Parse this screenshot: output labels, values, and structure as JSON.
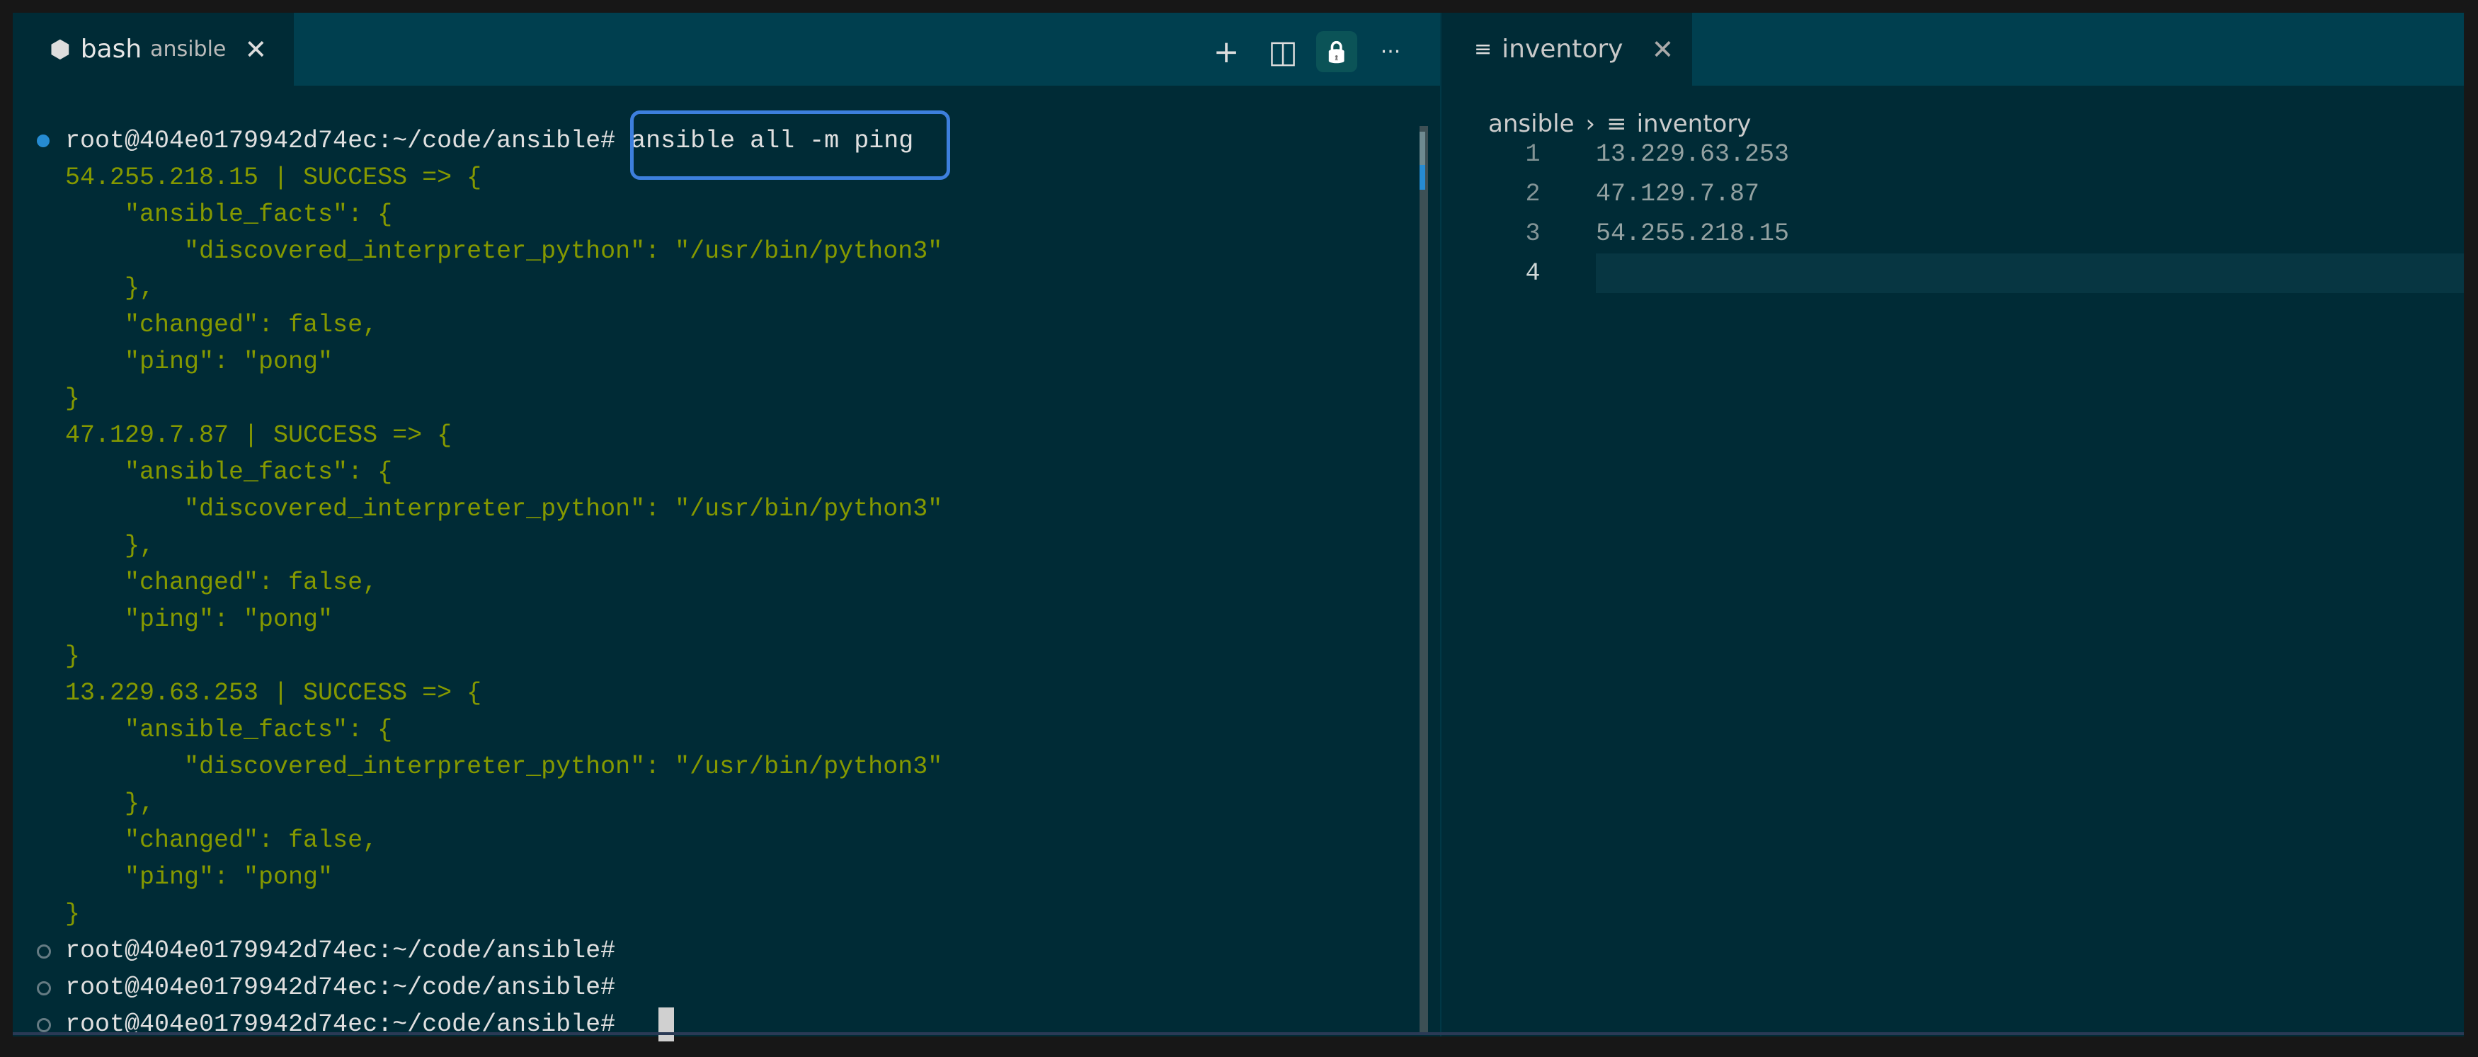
{
  "terminal_tab": {
    "icon": "terminal-cube-icon",
    "name": "bash",
    "cwd": "ansible",
    "close": "✕"
  },
  "terminal_actions": [
    {
      "name": "new-terminal-button",
      "icon": "plus-icon",
      "glyph": "+"
    },
    {
      "name": "split-terminal-button",
      "icon": "split-icon",
      "glyph": "◫"
    },
    {
      "name": "lock-button",
      "icon": "lock-icon",
      "glyph": "🔒"
    },
    {
      "name": "more-actions-button",
      "icon": "ellipsis-icon",
      "glyph": "···"
    }
  ],
  "terminal": {
    "prompt": "root@404e0179942d74ec:~/code/ansible#",
    "command": "ansible all -m ping",
    "output": [
      "54.255.218.15 | SUCCESS => {",
      "    \"ansible_facts\": {",
      "        \"discovered_interpreter_python\": \"/usr/bin/python3\"",
      "    },",
      "    \"changed\": false,",
      "    \"ping\": \"pong\"",
      "}",
      "47.129.7.87 | SUCCESS => {",
      "    \"ansible_facts\": {",
      "        \"discovered_interpreter_python\": \"/usr/bin/python3\"",
      "    },",
      "    \"changed\": false,",
      "    \"ping\": \"pong\"",
      "}",
      "13.229.63.253 | SUCCESS => {",
      "    \"ansible_facts\": {",
      "        \"discovered_interpreter_python\": \"/usr/bin/python3\"",
      "    },",
      "    \"changed\": false,",
      "    \"ping\": \"pong\"",
      "}"
    ],
    "trailing_prompts": 3
  },
  "editor_tab": {
    "icon": "file-lines-icon",
    "name": "inventory",
    "close": "✕"
  },
  "breadcrumb": {
    "folder": "ansible",
    "separator": "›",
    "file": "inventory"
  },
  "editor_lines": [
    {
      "n": "1",
      "text": "13.229.63.253"
    },
    {
      "n": "2",
      "text": "47.129.7.87"
    },
    {
      "n": "3",
      "text": "54.255.218.15"
    },
    {
      "n": "4",
      "text": ""
    }
  ],
  "colors": {
    "background": "#002b36",
    "tabbar": "#003f4f",
    "output": "#859900",
    "highlight_box": "#3d7fdd"
  }
}
